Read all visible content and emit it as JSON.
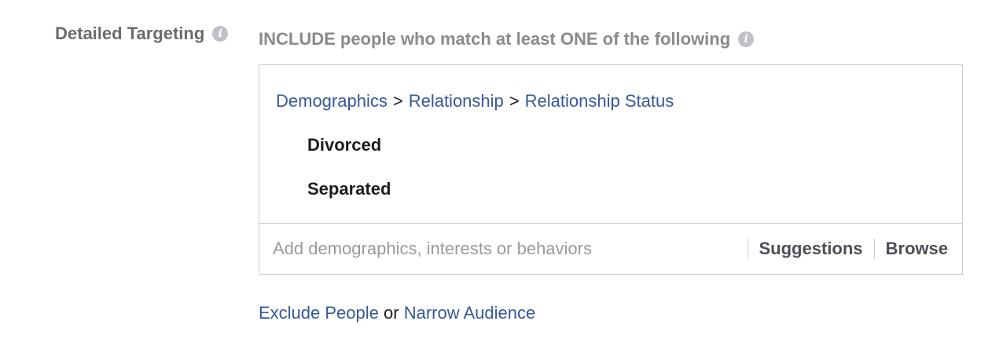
{
  "detailed_targeting": {
    "label": "Detailed Targeting",
    "info_icon": "info-icon"
  },
  "include": {
    "heading": "INCLUDE people who match at least ONE of the following",
    "info_icon": "info-icon"
  },
  "breadcrumb": {
    "items": [
      "Demographics",
      "Relationship",
      "Relationship Status"
    ],
    "separator": ">"
  },
  "selected_items": [
    "Divorced",
    "Separated"
  ],
  "search": {
    "placeholder": "Add demographics, interests or behaviors",
    "value": ""
  },
  "actions": {
    "suggestions": "Suggestions",
    "browse": "Browse"
  },
  "footer": {
    "exclude": "Exclude People",
    "or": "or",
    "narrow": "Narrow Audience"
  },
  "colors": {
    "link": "#365899",
    "label": "#6b6b6b",
    "border": "#c9ced6"
  }
}
